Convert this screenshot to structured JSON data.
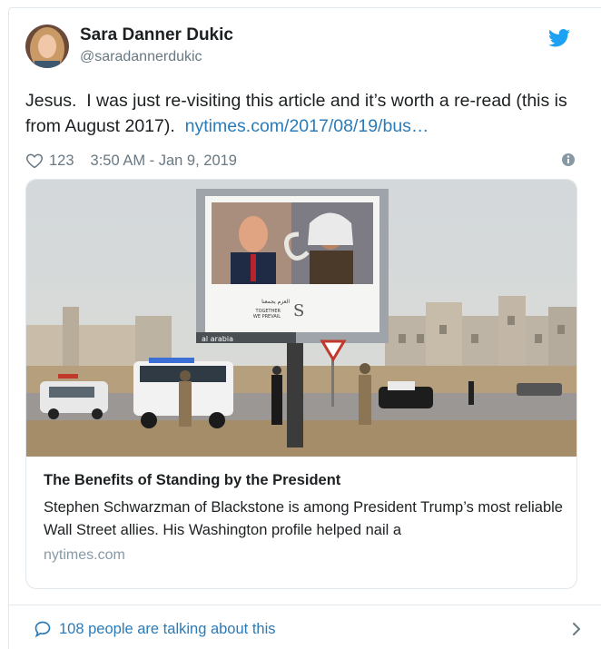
{
  "tweet": {
    "author_name": "Sara Danner Dukic",
    "author_handle": "@saradannerdukic",
    "text_before_link": "Jesus.  I was just re-visiting this article and it’s worth a re-read (this is from August 2017).  ",
    "link_text": "nytimes.com/2017/08/19/bus…",
    "like_count": "123",
    "timestamp": "3:50 AM - Jan 9, 2019"
  },
  "card": {
    "title": "The Benefits of Standing by the President",
    "description": "Stephen Schwarzman of Blackstone is among President Trump’s most reliable Wall Street allies. His Washington profile helped nail a",
    "domain": "nytimes.com",
    "billboard_text": {
      "arabic_line": "العزم يجمعنا",
      "english_line1": "TOGETHER",
      "english_line2": "WE PREVAIL",
      "sponsor": "al arabia"
    }
  },
  "footer": {
    "talking_text": "108 people are talking about this"
  },
  "colors": {
    "link": "#2b7bb9",
    "twitter_blue": "#1da1f2",
    "muted": "#697882",
    "border": "#e1e8ed"
  },
  "icons": {
    "brand": "twitter-bird-icon",
    "like": "heart-icon",
    "info": "info-icon",
    "reply": "speech-bubble-icon",
    "more": "chevron-right-icon"
  }
}
